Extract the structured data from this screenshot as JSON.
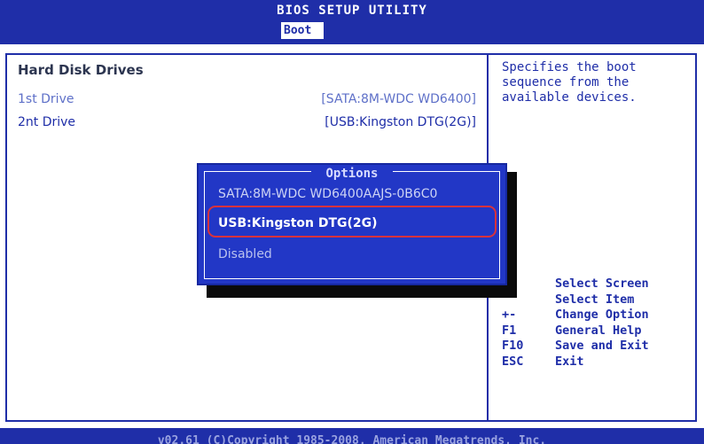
{
  "window": {
    "title": "BIOS SETUP UTILITY",
    "active_tab": "Boot"
  },
  "section": {
    "title": "Hard Disk Drives",
    "drives": [
      {
        "label": "1st Drive",
        "value": "[SATA:8M-WDC WD6400]"
      },
      {
        "label": "2nt Drive",
        "value": "[USB:Kingston DTG(2G)]"
      }
    ]
  },
  "help": {
    "text": "Specifies the boot\nsequence from the\navailable devices."
  },
  "options_popup": {
    "title": "Options",
    "items": [
      {
        "label": "SATA:8M-WDC WD6400AAJS-0B6C0"
      },
      {
        "label": "USB:Kingston DTG(2G)",
        "highlighted": true
      },
      {
        "label": "Disabled"
      }
    ]
  },
  "key_legend": {
    "rows": [
      {
        "key": "",
        "desc": "Select Screen"
      },
      {
        "key": "",
        "desc": "Select Item"
      },
      {
        "key": "+-",
        "desc": "Change Option"
      },
      {
        "key": "F1",
        "desc": "General Help"
      },
      {
        "key": "F10",
        "desc": "Save and Exit"
      },
      {
        "key": "ESC",
        "desc": "Exit"
      }
    ]
  },
  "footer": {
    "text": "v02.61 (C)Copyright 1985-2008, American Megatrends, Inc."
  },
  "colors": {
    "bios_blue": "#1f2ea8",
    "popup_blue": "#2237c6",
    "highlight_red": "#d8323c"
  }
}
